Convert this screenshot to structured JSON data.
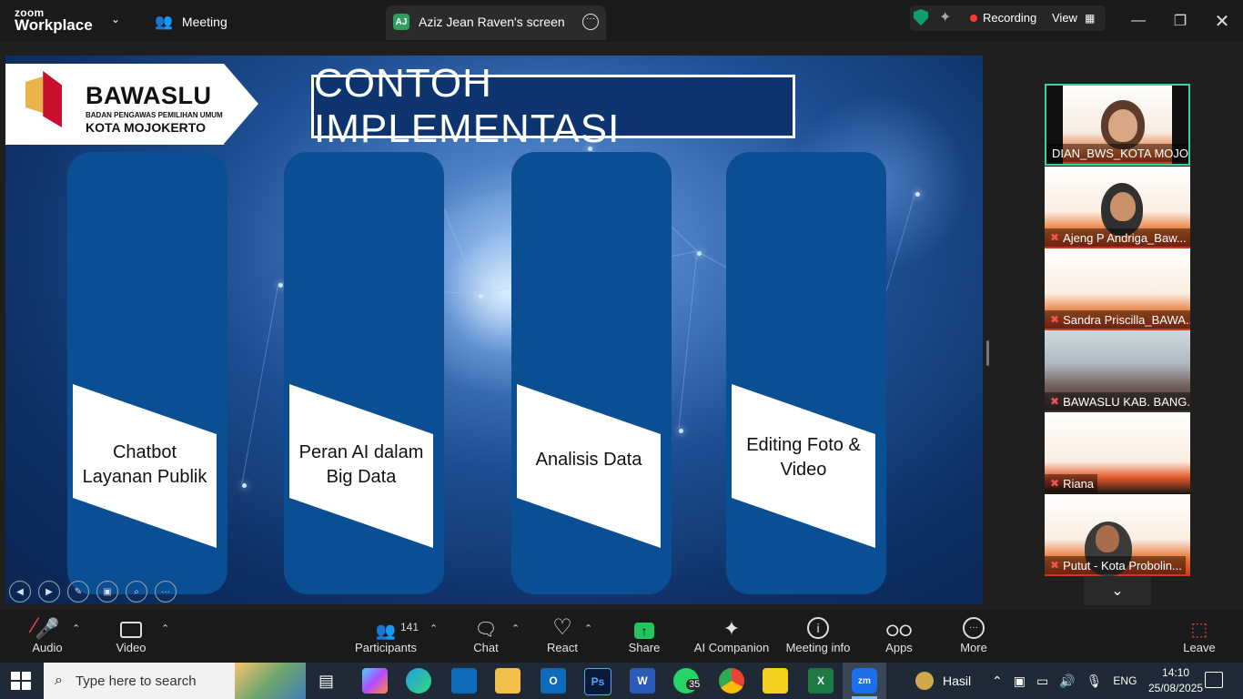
{
  "app": {
    "brand_small": "zoom",
    "brand_big": "Workplace",
    "meeting_label": "Meeting",
    "screen_tab_avatar": "AJ",
    "screen_tab_title": "Aziz Jean Raven's screen",
    "recording_label": "Recording",
    "view_label": "View"
  },
  "slide": {
    "logo_title": "BAWASLU",
    "logo_subtitle": "BADAN PENGAWAS PEMILIHAN UMUM",
    "logo_city": "KOTA MOJOKERTO",
    "heading": "CONTOH IMPLEMENTASI",
    "cards": [
      {
        "line1": "Chatbot",
        "line2": "Layanan Publik"
      },
      {
        "line1": "Peran AI dalam",
        "line2": "Big Data"
      },
      {
        "line1": "Analisis Data",
        "line2": ""
      },
      {
        "line1": "Editing Foto &",
        "line2": "Video"
      }
    ]
  },
  "participants_panel": [
    {
      "name": "DIAN_BWS_KOTA MOJO...",
      "muted": false
    },
    {
      "name": "Ajeng P Andriga_Baw...",
      "muted": true
    },
    {
      "name": "Sandra Priscilla_BAWA...",
      "muted": true
    },
    {
      "name": "BAWASLU KAB. BANG...",
      "muted": true
    },
    {
      "name": "Riana",
      "muted": true
    },
    {
      "name": "Putut - Kota Probolin...",
      "muted": true
    }
  ],
  "toolbar": {
    "audio": "Audio",
    "video": "Video",
    "participants": "Participants",
    "participants_count": "141",
    "chat": "Chat",
    "react": "React",
    "share": "Share",
    "ai_companion": "AI Companion",
    "meeting_info": "Meeting info",
    "apps": "Apps",
    "more": "More",
    "leave": "Leave"
  },
  "taskbar": {
    "search_placeholder": "Type here to search",
    "whatsapp_badge": "35",
    "weather": "Hasil",
    "language": "ENG",
    "time": "14:10",
    "date": "25/08/2025"
  },
  "colors": {
    "accent_green": "#0e9f6e",
    "share_green": "#22c55e",
    "record_red": "#ff3b30",
    "card_blue": "#0a4f93"
  }
}
